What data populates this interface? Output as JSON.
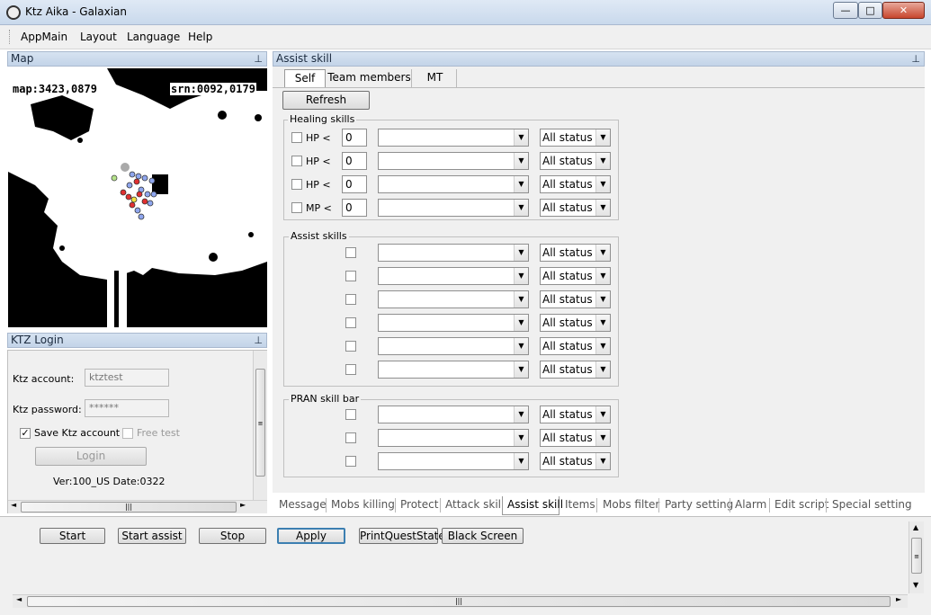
{
  "window": {
    "title": "Ktz Aika - Galaxian",
    "minimize": "—",
    "maximize": "□",
    "close": "✕"
  },
  "menu": [
    "AppMain",
    "Layout",
    "Language",
    "Help"
  ],
  "map_panel": {
    "title": "Map",
    "pin": "⊥",
    "map_coords": "map:3423,0879",
    "srn_coords": "srn:0092,0179"
  },
  "login_panel": {
    "title": "KTZ Login",
    "pin": "⊥",
    "account_label": "Ktz account:",
    "account_value": "ktztest",
    "password_label": "Ktz password:",
    "password_value": "******",
    "save_label": "Save Ktz account",
    "save_checked": "✓",
    "free_test_label": "Free test",
    "login_button": "Login",
    "version": "Ver:100_US Date:0322",
    "scroll_grip": "|||"
  },
  "assist_panel": {
    "title": "Assist skill",
    "pin": "⊥",
    "tabs": [
      "Self",
      "Team members",
      "MT"
    ],
    "refresh_button": "Refresh",
    "healing": {
      "title": "Healing skills",
      "rows": [
        {
          "label": "HP <",
          "value": "0",
          "status": "All status"
        },
        {
          "label": "HP <",
          "value": "0",
          "status": "All status"
        },
        {
          "label": "HP <",
          "value": "0",
          "status": "All status"
        },
        {
          "label": "MP <",
          "value": "0",
          "status": "All status"
        }
      ]
    },
    "assist": {
      "title": "Assist skills",
      "rows": [
        {
          "status": "All status"
        },
        {
          "status": "All status"
        },
        {
          "status": "All status"
        },
        {
          "status": "All status"
        },
        {
          "status": "All status"
        },
        {
          "status": "All status"
        }
      ]
    },
    "pran": {
      "title": "PRAN skill bar",
      "rows": [
        {
          "status": "All status"
        },
        {
          "status": "All status"
        },
        {
          "status": "All status"
        }
      ]
    },
    "dropdown_arrow": "▼"
  },
  "bottom_tabs": [
    "Message",
    "Mobs killing",
    "Protect",
    "Attack skill",
    "Assist skill",
    "Items",
    "Mobs filter",
    "Party setting",
    "Alarm",
    "Edit script",
    "Special setting"
  ],
  "actions": [
    "Start",
    "Start assist",
    "Stop",
    "Apply",
    "PrintQuestState",
    "Black Screen"
  ],
  "lower_scroll": {
    "left_arrow": "◄",
    "right_arrow": "►",
    "up_arrow": "▲",
    "down_arrow": "▼",
    "grip": "|||"
  }
}
